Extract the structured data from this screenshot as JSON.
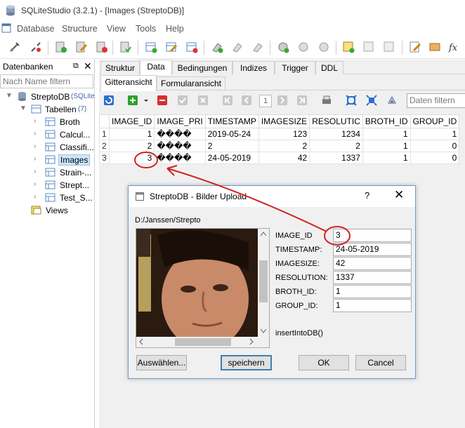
{
  "window": {
    "title": "SQLiteStudio (3.2.1) - [Images (StreptoDB)]"
  },
  "menu": [
    "Database",
    "Structure",
    "View",
    "Tools",
    "Help"
  ],
  "left_panel": {
    "title": "Datenbanken",
    "filter_placeholder": "Nach Name filtern",
    "db_name": "StreptoDB",
    "db_type": "(SQLite",
    "tables_label": "Tabellen",
    "tables_count": "(7)",
    "tables": [
      "Broth",
      "Calcul...",
      "Classifi...",
      "Images",
      "Strain-...",
      "Strept...",
      "Test_S..."
    ],
    "views_label": "Views"
  },
  "tabs": [
    "Struktur",
    "Data",
    "Bedingungen",
    "Indizes",
    "Trigger",
    "DDL"
  ],
  "subtabs": [
    "Gitteransicht",
    "Formularansicht"
  ],
  "grid_toolbar": {
    "page": "1",
    "filter_placeholder": "Daten filtern"
  },
  "grid": {
    "columns": [
      "IMAGE_ID",
      "IMAGE_PRI",
      "TIMESTAMP",
      "IMAGESIZE",
      "RESOLUTIC",
      "BROTH_ID",
      "GROUP_ID"
    ],
    "rows": [
      [
        "1",
        "1",
        "����",
        "2019-05-24",
        "123",
        "1234",
        "1",
        "1"
      ],
      [
        "2",
        "2",
        "����",
        "2",
        "2",
        "2",
        "1",
        "0"
      ],
      [
        "3",
        "3",
        "����",
        "24-05-2019",
        "42",
        "1337",
        "1",
        "0"
      ]
    ]
  },
  "dialog": {
    "title": "StreptoDB - Bilder Upload",
    "help": "?",
    "close": "✕",
    "path": "D:/Janssen/Strepto",
    "fields": [
      {
        "label": "IMAGE_ID",
        "value": "3"
      },
      {
        "label": "TIMESTAMP:",
        "value": "24-05-2019"
      },
      {
        "label": "IMAGESIZE:",
        "value": "42"
      },
      {
        "label": "RESOLUTION:",
        "value": "1337"
      },
      {
        "label": "BROTH_ID:",
        "value": "1"
      },
      {
        "label": "GROUP_ID:",
        "value": "1"
      }
    ],
    "method": "insertIntoDB()",
    "buttons": {
      "choose": "Auswählen...",
      "save": "speichern",
      "ok": "OK",
      "cancel": "Cancel"
    }
  },
  "colors": {
    "annotation": "#d42020",
    "selection": "#cce6ff",
    "dialog_border": "#6f9ad2"
  }
}
